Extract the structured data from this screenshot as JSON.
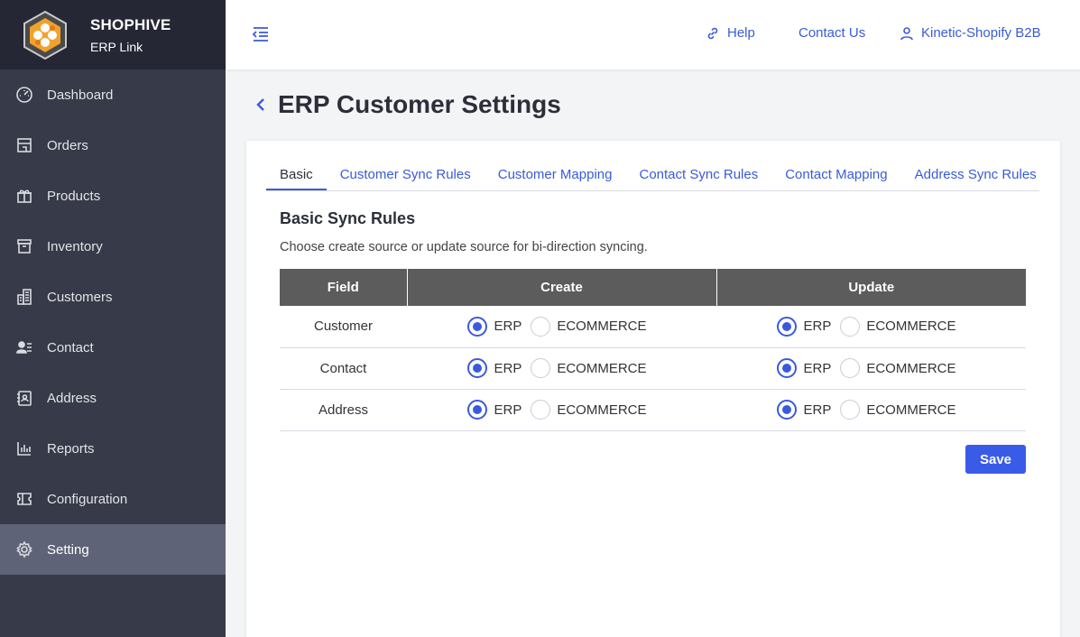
{
  "brand": {
    "name": "SHOPHIVE",
    "subtitle": "ERP Link"
  },
  "sidebar": {
    "items": [
      {
        "label": "Dashboard",
        "icon": "gauge-icon"
      },
      {
        "label": "Orders",
        "icon": "store-icon"
      },
      {
        "label": "Products",
        "icon": "gift-icon"
      },
      {
        "label": "Inventory",
        "icon": "archive-icon"
      },
      {
        "label": "Customers",
        "icon": "building-icon"
      },
      {
        "label": "Contact",
        "icon": "contact-card-icon"
      },
      {
        "label": "Address",
        "icon": "address-book-icon"
      },
      {
        "label": "Reports",
        "icon": "bar-chart-icon"
      },
      {
        "label": "Configuration",
        "icon": "ticket-icon"
      },
      {
        "label": "Setting",
        "icon": "gear-icon",
        "active": true
      }
    ]
  },
  "header": {
    "help": "Help",
    "contact": "Contact Us",
    "user": "Kinetic-Shopify B2B"
  },
  "page": {
    "title": "ERP Customer Settings"
  },
  "tabs": [
    {
      "label": "Basic",
      "active": true
    },
    {
      "label": "Customer Sync Rules"
    },
    {
      "label": "Customer Mapping"
    },
    {
      "label": "Contact Sync Rules"
    },
    {
      "label": "Contact Mapping"
    },
    {
      "label": "Address Sync Rules"
    }
  ],
  "section": {
    "title": "Basic Sync Rules",
    "description": "Choose create source or update source for bi-direction syncing."
  },
  "table": {
    "headers": [
      "Field",
      "Create",
      "Update"
    ],
    "option_erp": "ERP",
    "option_ecommerce": "ECOMMERCE",
    "rows": [
      {
        "field": "Customer",
        "create": "ERP",
        "update": "ERP"
      },
      {
        "field": "Contact",
        "create": "ERP",
        "update": "ERP"
      },
      {
        "field": "Address",
        "create": "ERP",
        "update": "ERP"
      }
    ]
  },
  "actions": {
    "save": "Save"
  },
  "colors": {
    "accent": "#3a5bd9",
    "sidebar": "#373a48",
    "sidebar_active": "#5f6377",
    "table_header": "#5c5c5c"
  }
}
